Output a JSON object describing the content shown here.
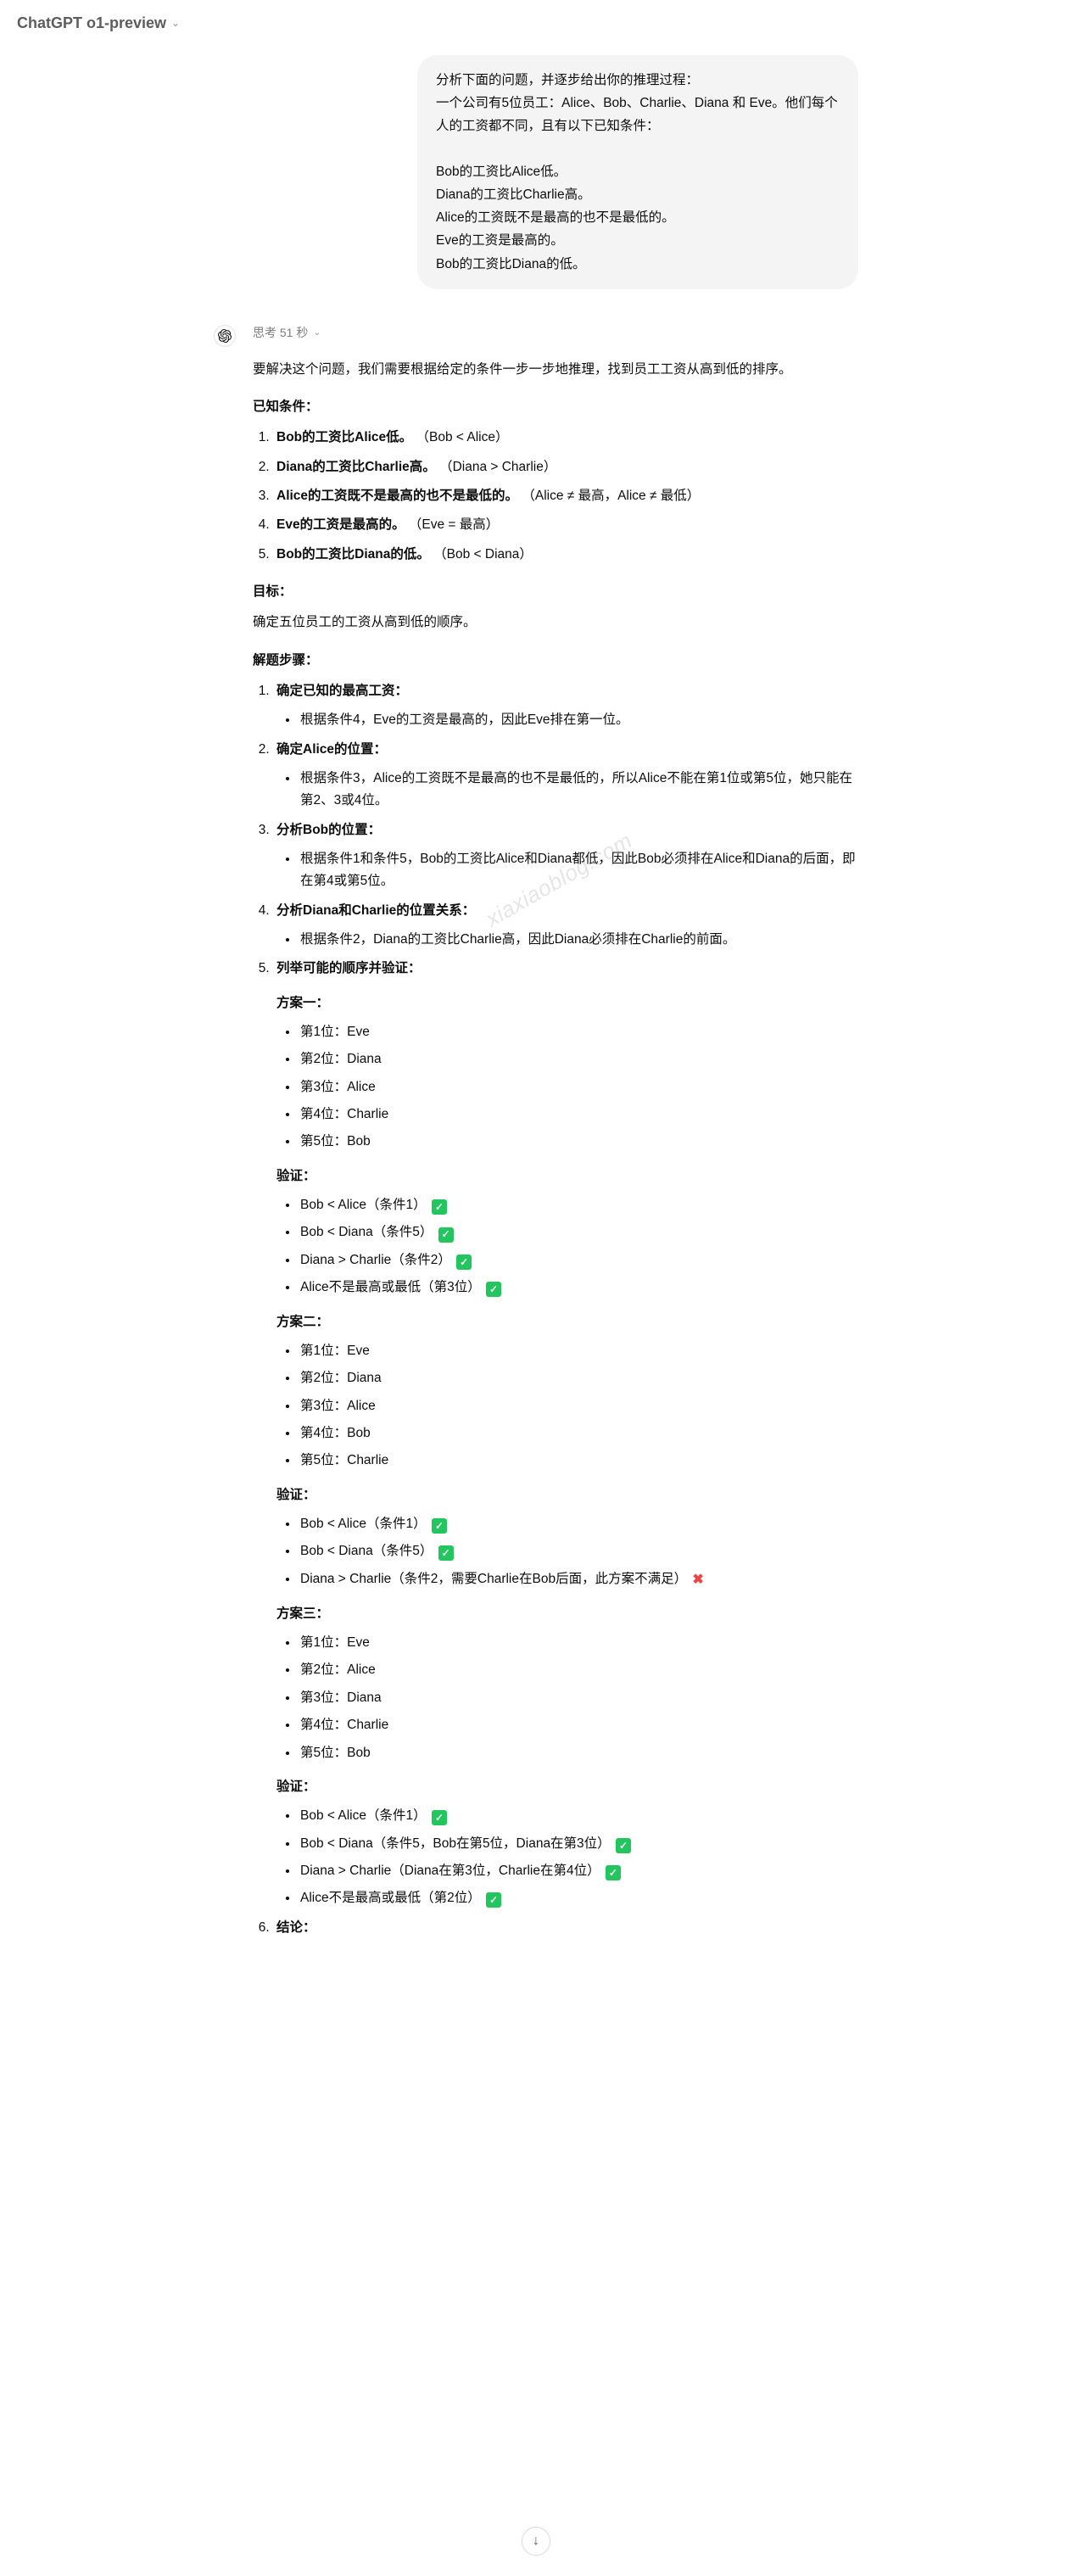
{
  "header": {
    "title": "ChatGPT o1-preview"
  },
  "watermark": "xiaxiaoblog.com",
  "thinking": {
    "label": "思考 51 秒"
  },
  "user_message": "分析下面的问题，并逐步给出你的推理过程：\n一个公司有5位员工：Alice、Bob、Charlie、Diana 和 Eve。他们每个人的工资都不同，且有以下已知条件：\n\nBob的工资比Alice低。\nDiana的工资比Charlie高。\nAlice的工资既不是最高的也不是最低的。\nEve的工资是最高的。\nBob的工资比Diana的低。",
  "assistant": {
    "intro": "要解决这个问题，我们需要根据给定的条件一步一步地推理，找到员工工资从高到低的排序。",
    "known_heading": "已知条件：",
    "known": [
      {
        "bold": "Bob的工资比Alice低。",
        "note": "（Bob < Alice）"
      },
      {
        "bold": "Diana的工资比Charlie高。",
        "note": "（Diana > Charlie）"
      },
      {
        "bold": "Alice的工资既不是最高的也不是最低的。",
        "note": "（Alice ≠ 最高，Alice ≠ 最低）"
      },
      {
        "bold": "Eve的工资是最高的。",
        "note": "（Eve = 最高）"
      },
      {
        "bold": "Bob的工资比Diana的低。",
        "note": "（Bob < Diana）"
      }
    ],
    "goal_heading": "目标：",
    "goal_text": "确定五位员工的工资从高到低的顺序。",
    "steps_heading": "解题步骤：",
    "steps": [
      {
        "title": "确定已知的最高工资：",
        "bullets": [
          "根据条件4，Eve的工资是最高的，因此Eve排在第一位。"
        ]
      },
      {
        "title": "确定Alice的位置：",
        "bullets": [
          "根据条件3，Alice的工资既不是最高的也不是最低的，所以Alice不能在第1位或第5位，她只能在第2、3或4位。"
        ]
      },
      {
        "title": "分析Bob的位置：",
        "bullets": [
          "根据条件1和条件5，Bob的工资比Alice和Diana都低，因此Bob必须排在Alice和Diana的后面，即在第4或第5位。"
        ]
      },
      {
        "title": "分析Diana和Charlie的位置关系：",
        "bullets": [
          "根据条件2，Diana的工资比Charlie高，因此Diana必须排在Charlie的前面。"
        ]
      },
      {
        "title": "列举可能的顺序并验证：",
        "scenarios": [
          {
            "name": "方案一：",
            "ranks": [
              "第1位：Eve",
              "第2位：Diana",
              "第3位：Alice",
              "第4位：Charlie",
              "第5位：Bob"
            ],
            "verify_label": "验证：",
            "verify": [
              {
                "text": "Bob < Alice（条件1）",
                "mark": "check"
              },
              {
                "text": "Bob < Diana（条件5）",
                "mark": "check"
              },
              {
                "text": "Diana > Charlie（条件2）",
                "mark": "check"
              },
              {
                "text": "Alice不是最高或最低（第3位）",
                "mark": "check"
              }
            ]
          },
          {
            "name": "方案二：",
            "ranks": [
              "第1位：Eve",
              "第2位：Diana",
              "第3位：Alice",
              "第4位：Bob",
              "第5位：Charlie"
            ],
            "verify_label": "验证：",
            "verify": [
              {
                "text": "Bob < Alice（条件1）",
                "mark": "check"
              },
              {
                "text": "Bob < Diana（条件5）",
                "mark": "check"
              },
              {
                "text": "Diana > Charlie（条件2，需要Charlie在Bob后面，此方案不满足）",
                "mark": "cross"
              }
            ]
          },
          {
            "name": "方案三：",
            "ranks": [
              "第1位：Eve",
              "第2位：Alice",
              "第3位：Diana",
              "第4位：Charlie",
              "第5位：Bob"
            ],
            "verify_label": "验证：",
            "verify": [
              {
                "text": "Bob < Alice（条件1）",
                "mark": "check"
              },
              {
                "text": "Bob < Diana（条件5，Bob在第5位，Diana在第3位）",
                "mark": "check"
              },
              {
                "text": "Diana > Charlie（Diana在第3位，Charlie在第4位）",
                "mark": "check"
              },
              {
                "text": "Alice不是最高或最低（第2位）",
                "mark": "check"
              }
            ]
          }
        ]
      },
      {
        "title": "结论："
      }
    ]
  }
}
